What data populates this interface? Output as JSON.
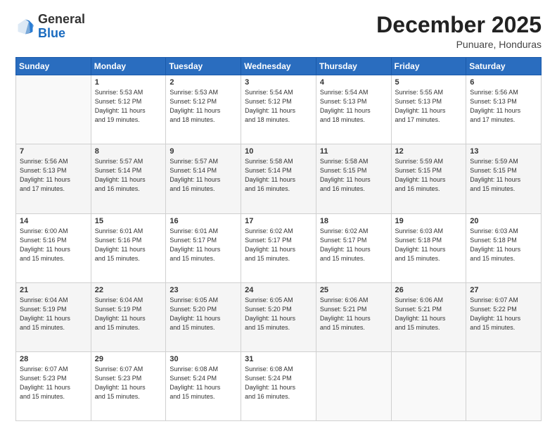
{
  "header": {
    "logo_general": "General",
    "logo_blue": "Blue",
    "month_title": "December 2025",
    "location": "Punuare, Honduras"
  },
  "days_of_week": [
    "Sunday",
    "Monday",
    "Tuesday",
    "Wednesday",
    "Thursday",
    "Friday",
    "Saturday"
  ],
  "weeks": [
    [
      {
        "day": "",
        "info": ""
      },
      {
        "day": "1",
        "info": "Sunrise: 5:53 AM\nSunset: 5:12 PM\nDaylight: 11 hours\nand 19 minutes."
      },
      {
        "day": "2",
        "info": "Sunrise: 5:53 AM\nSunset: 5:12 PM\nDaylight: 11 hours\nand 18 minutes."
      },
      {
        "day": "3",
        "info": "Sunrise: 5:54 AM\nSunset: 5:12 PM\nDaylight: 11 hours\nand 18 minutes."
      },
      {
        "day": "4",
        "info": "Sunrise: 5:54 AM\nSunset: 5:13 PM\nDaylight: 11 hours\nand 18 minutes."
      },
      {
        "day": "5",
        "info": "Sunrise: 5:55 AM\nSunset: 5:13 PM\nDaylight: 11 hours\nand 17 minutes."
      },
      {
        "day": "6",
        "info": "Sunrise: 5:56 AM\nSunset: 5:13 PM\nDaylight: 11 hours\nand 17 minutes."
      }
    ],
    [
      {
        "day": "7",
        "info": "Sunrise: 5:56 AM\nSunset: 5:13 PM\nDaylight: 11 hours\nand 17 minutes."
      },
      {
        "day": "8",
        "info": "Sunrise: 5:57 AM\nSunset: 5:14 PM\nDaylight: 11 hours\nand 16 minutes."
      },
      {
        "day": "9",
        "info": "Sunrise: 5:57 AM\nSunset: 5:14 PM\nDaylight: 11 hours\nand 16 minutes."
      },
      {
        "day": "10",
        "info": "Sunrise: 5:58 AM\nSunset: 5:14 PM\nDaylight: 11 hours\nand 16 minutes."
      },
      {
        "day": "11",
        "info": "Sunrise: 5:58 AM\nSunset: 5:15 PM\nDaylight: 11 hours\nand 16 minutes."
      },
      {
        "day": "12",
        "info": "Sunrise: 5:59 AM\nSunset: 5:15 PM\nDaylight: 11 hours\nand 16 minutes."
      },
      {
        "day": "13",
        "info": "Sunrise: 5:59 AM\nSunset: 5:15 PM\nDaylight: 11 hours\nand 15 minutes."
      }
    ],
    [
      {
        "day": "14",
        "info": "Sunrise: 6:00 AM\nSunset: 5:16 PM\nDaylight: 11 hours\nand 15 minutes."
      },
      {
        "day": "15",
        "info": "Sunrise: 6:01 AM\nSunset: 5:16 PM\nDaylight: 11 hours\nand 15 minutes."
      },
      {
        "day": "16",
        "info": "Sunrise: 6:01 AM\nSunset: 5:17 PM\nDaylight: 11 hours\nand 15 minutes."
      },
      {
        "day": "17",
        "info": "Sunrise: 6:02 AM\nSunset: 5:17 PM\nDaylight: 11 hours\nand 15 minutes."
      },
      {
        "day": "18",
        "info": "Sunrise: 6:02 AM\nSunset: 5:17 PM\nDaylight: 11 hours\nand 15 minutes."
      },
      {
        "day": "19",
        "info": "Sunrise: 6:03 AM\nSunset: 5:18 PM\nDaylight: 11 hours\nand 15 minutes."
      },
      {
        "day": "20",
        "info": "Sunrise: 6:03 AM\nSunset: 5:18 PM\nDaylight: 11 hours\nand 15 minutes."
      }
    ],
    [
      {
        "day": "21",
        "info": "Sunrise: 6:04 AM\nSunset: 5:19 PM\nDaylight: 11 hours\nand 15 minutes."
      },
      {
        "day": "22",
        "info": "Sunrise: 6:04 AM\nSunset: 5:19 PM\nDaylight: 11 hours\nand 15 minutes."
      },
      {
        "day": "23",
        "info": "Sunrise: 6:05 AM\nSunset: 5:20 PM\nDaylight: 11 hours\nand 15 minutes."
      },
      {
        "day": "24",
        "info": "Sunrise: 6:05 AM\nSunset: 5:20 PM\nDaylight: 11 hours\nand 15 minutes."
      },
      {
        "day": "25",
        "info": "Sunrise: 6:06 AM\nSunset: 5:21 PM\nDaylight: 11 hours\nand 15 minutes."
      },
      {
        "day": "26",
        "info": "Sunrise: 6:06 AM\nSunset: 5:21 PM\nDaylight: 11 hours\nand 15 minutes."
      },
      {
        "day": "27",
        "info": "Sunrise: 6:07 AM\nSunset: 5:22 PM\nDaylight: 11 hours\nand 15 minutes."
      }
    ],
    [
      {
        "day": "28",
        "info": "Sunrise: 6:07 AM\nSunset: 5:23 PM\nDaylight: 11 hours\nand 15 minutes."
      },
      {
        "day": "29",
        "info": "Sunrise: 6:07 AM\nSunset: 5:23 PM\nDaylight: 11 hours\nand 15 minutes."
      },
      {
        "day": "30",
        "info": "Sunrise: 6:08 AM\nSunset: 5:24 PM\nDaylight: 11 hours\nand 15 minutes."
      },
      {
        "day": "31",
        "info": "Sunrise: 6:08 AM\nSunset: 5:24 PM\nDaylight: 11 hours\nand 16 minutes."
      },
      {
        "day": "",
        "info": ""
      },
      {
        "day": "",
        "info": ""
      },
      {
        "day": "",
        "info": ""
      }
    ]
  ]
}
